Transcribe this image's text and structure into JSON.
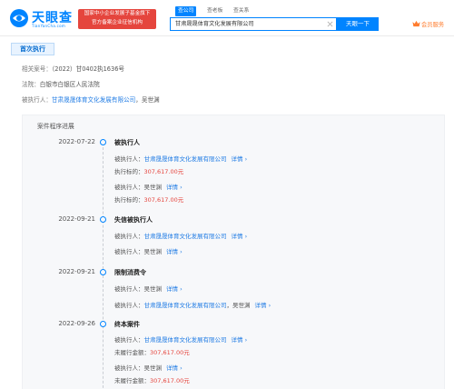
{
  "header": {
    "logo_cn": "天眼查",
    "logo_en": "TianYanCha.com",
    "promo_line1": "国家中小企业发展子基金旗下",
    "promo_line2": "官方备案企业征信机构",
    "search_tabs": [
      "查公司",
      "查老板",
      "查关系"
    ],
    "search_value": "甘肃晟晟体育文化发展有限公司",
    "search_button": "天眼一下",
    "member_label": "会员服务"
  },
  "section": {
    "title": "首次执行",
    "case_no_label": "相关案号：",
    "case_no": "（2022）甘0402执1636号",
    "court_label": "法院：",
    "court": "白银市白银区人民法院",
    "executed_label": "被执行人：",
    "executed_company": "甘肃晟晟体育文化发展有限公司",
    "executed_sep": "，",
    "executed_person": "吴世渊"
  },
  "progress": {
    "title": "案件程序进展",
    "events": [
      {
        "date": "2022-07-22",
        "title": "被执行人",
        "lines": [
          {
            "label": "被执行人：",
            "value": "甘肃晟晟体育文化发展有限公司",
            "link": "详情 ›"
          },
          {
            "label": "执行标的：",
            "money": "307,617.00元"
          },
          {
            "label": "被执行人：",
            "plain": "吴世渊",
            "link": "详情 ›"
          },
          {
            "label": "执行标的：",
            "money": "307,617.00元"
          }
        ]
      },
      {
        "date": "2022-09-21",
        "title": "失信被执行人",
        "lines": [
          {
            "label": "被执行人：",
            "value": "甘肃晟晟体育文化发展有限公司",
            "link": "详情 ›"
          },
          {
            "label": "被执行人：",
            "plain": "吴世渊",
            "link": "详情 ›"
          }
        ]
      },
      {
        "date": "2022-09-21",
        "title": "限制消费令",
        "lines": [
          {
            "label": "被执行人：",
            "plain": "吴世渊",
            "link": "详情 ›"
          },
          {
            "label": "被执行人：",
            "value": "甘肃晟晟体育文化发展有限公司",
            "sep": "，",
            "plain": "吴世渊",
            "link": "详情 ›"
          }
        ]
      },
      {
        "date": "2022-09-26",
        "title": "终本案件",
        "lines": [
          {
            "label": "被执行人：",
            "value": "甘肃晟晟体育文化发展有限公司",
            "link": "详情 ›"
          },
          {
            "label": "未履行金额：",
            "money": "307,617.00元"
          },
          {
            "label": "被执行人：",
            "plain": "吴世渊",
            "link": "详情 ›"
          },
          {
            "label": "未履行金额：",
            "money": "307,617.00元"
          }
        ]
      }
    ]
  },
  "colors": {
    "brand_blue": "#0084ff",
    "link_blue": "#1f7be4",
    "money_red": "#e5453d",
    "member_orange": "#ff7d2f"
  }
}
